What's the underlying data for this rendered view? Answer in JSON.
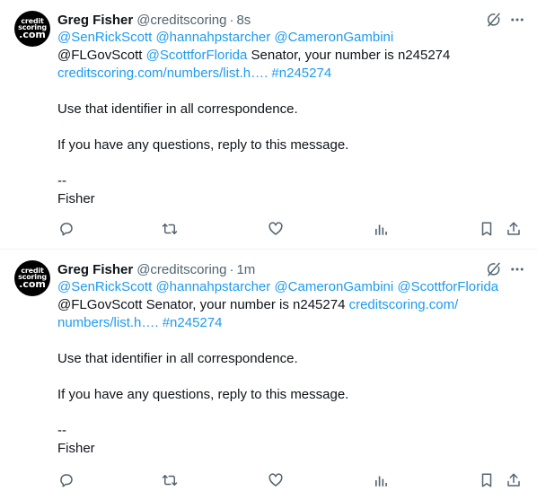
{
  "tweets": [
    {
      "avatar": {
        "line1": "credit",
        "line2": "scoring",
        "line3": ".com"
      },
      "name": "Greg Fisher",
      "handle": "@creditscoring",
      "separator": "·",
      "time": "8s",
      "line1": {
        "mentions": [
          "@SenRickScott",
          "@hannahpstarcher",
          "@CameronGambini"
        ]
      },
      "line2": {
        "plain1": "@FLGovScott ",
        "mention": "@ScottforFlorida",
        "plain2": " Senator, your number is n245274"
      },
      "line3": {
        "url": "creditscoring.com/numbers/list.h….",
        "hashtag": "#n245274"
      },
      "para1": "Use that identifier in all correspondence.",
      "para2": "If you have any questions, reply to this message.",
      "sig_dash": "--",
      "sig_name": "Fisher"
    },
    {
      "avatar": {
        "line1": "credit",
        "line2": "scoring",
        "line3": ".com"
      },
      "name": "Greg Fisher",
      "handle": "@creditscoring",
      "separator": "·",
      "time": "1m",
      "line1": {
        "mentions": [
          "@SenRickScott",
          "@hannahpstarcher",
          "@CameronGambini",
          "@ScottforFlorida"
        ]
      },
      "line2": {
        "plain1": "@FLGovScott Senator, your number is n245274 ",
        "url": "creditscoring.com/"
      },
      "line3": {
        "url": "numbers/list.h….",
        "hashtag": "#n245274"
      },
      "para1": "Use that identifier in all correspondence.",
      "para2": "If you have any questions, reply to this message.",
      "sig_dash": "--",
      "sig_name": "Fisher"
    }
  ],
  "icons": {
    "header": [
      "grok-icon",
      "more-icon"
    ],
    "actions": [
      "reply-icon",
      "retweet-icon",
      "like-icon",
      "views-icon",
      "bookmark-icon",
      "share-icon"
    ]
  },
  "colors": {
    "link": "#1d9bf0",
    "text": "#0f1419",
    "secondary": "#536471",
    "border": "#eff3f4"
  }
}
